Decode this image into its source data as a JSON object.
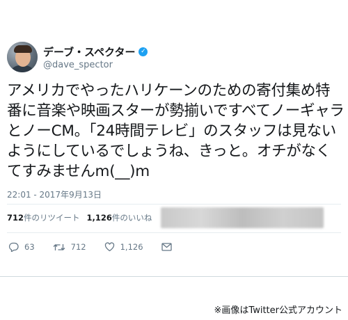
{
  "tweet": {
    "display_name": "デーブ・スペクター",
    "handle": "@dave_spector",
    "text": "アメリカでやったハリケーンのための寄付集め特番に音楽や映画スターが勢揃いですべてノーギャラとノーCM。「24時間テレビ」のスタッフは見ないようにしているでしょうね、きっと。オチがなくてすみませんm(__)m",
    "timestamp": "22:01 - 2017年9月13日",
    "verified_icon": "verified-badge-icon",
    "accent_color": "#1da1f2"
  },
  "stats": {
    "retweets_count": "712",
    "retweets_label": "件のリツイート",
    "likes_count": "1,126",
    "likes_label": "件のいいね"
  },
  "actions": {
    "reply_count": "63",
    "retweet_count": "712",
    "like_count": "1,126"
  },
  "caption": "※画像はTwitter公式アカウント"
}
